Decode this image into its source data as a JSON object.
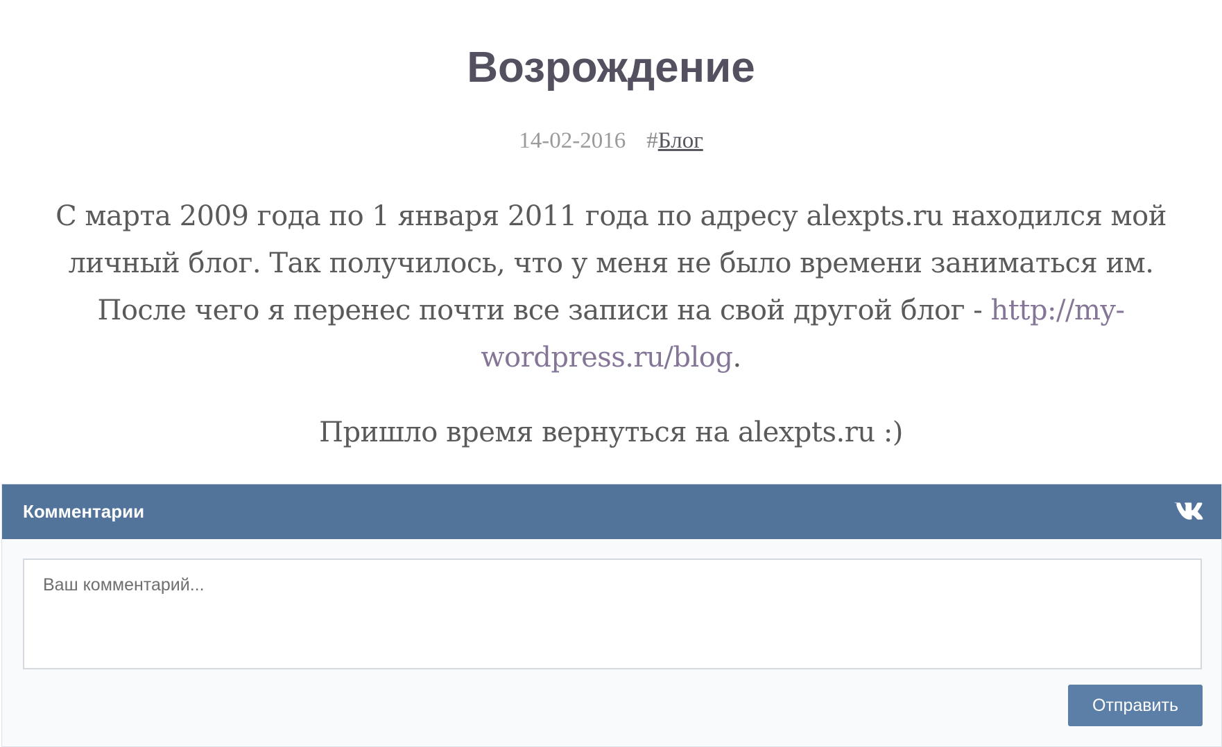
{
  "post": {
    "title": "Возрождение",
    "date": "14-02-2016",
    "tag_hash": "#",
    "tag_label": "Блог",
    "paragraph1_text": "С марта 2009 года по 1 января 2011 года по адресу alexpts.ru находился мой личный блог. Так получилось, что у меня не было времени заниматься им. После чего я перенес почти все записи на свой другой блог - ",
    "paragraph1_link": "http://my-wordpress.ru/blog",
    "paragraph1_end": ".",
    "paragraph2_text": "Пришло время вернуться на alexpts.ru :)"
  },
  "comments": {
    "title": "Комментарии",
    "logo_icon": "vk-logo-icon",
    "input_value": "",
    "input_placeholder": "Ваш комментарий...",
    "submit_label": "Отправить",
    "header_color": "#52739a",
    "button_color": "#5b7fa6"
  }
}
